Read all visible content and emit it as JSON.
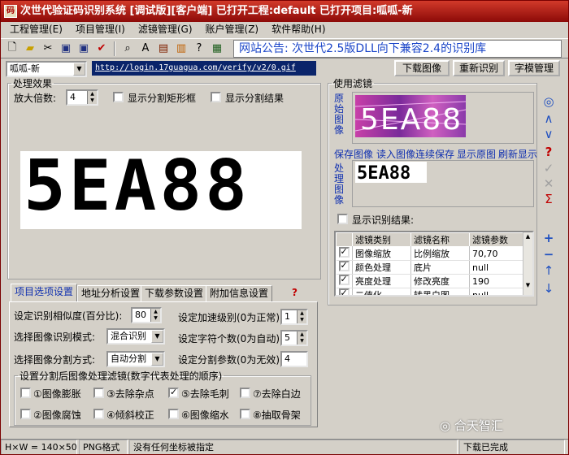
{
  "window": {
    "title": "次世代验证码识别系统 [调试版][客户端] 已打开工程:default 已打开项目:呱呱-新"
  },
  "menu": [
    "工程管理(E)",
    "项目管理(I)",
    "滤镜管理(G)",
    "账户管理(Z)",
    "软件帮助(H)"
  ],
  "announcement": "网站公告: 次世代2.5版DLL向下兼容2.4的识别库",
  "address": {
    "project": "呱呱-新",
    "url": "http://login.17guagua.com/verify/v2/0.gif"
  },
  "buttons": {
    "download": "下载图像",
    "reidentify": "重新识别",
    "charmodel": "字模管理"
  },
  "effect": {
    "legend": "处理效果",
    "zoom_label": "放大倍数:",
    "zoom_value": "4",
    "show_split_rect": "显示分割矩形框",
    "show_split_result": "显示分割结果",
    "captcha_text": "5EA88"
  },
  "tabs": [
    "项目选项设置",
    "地址分析设置",
    "下载参数设置",
    "附加信息设置"
  ],
  "options": {
    "similarity_label": "设定识别相似度(百分比):",
    "similarity_value": "80",
    "accel_label": "设定加速级别(0为正常)",
    "accel_value": "1",
    "mode_label": "选择图像识别模式:",
    "mode_value": "混合识别",
    "charcount_label": "设定字符个数(0为自动)",
    "charcount_value": "5",
    "split_label": "选择图像分割方式:",
    "split_value": "自动分割",
    "splitparam_label": "设定分割参数(0为无效)",
    "splitparam_value": "4",
    "postfilter_legend": "设置分割后图像处理滤镜(数字代表处理的顺序)",
    "postfilters": [
      {
        "label": "①图像膨胀",
        "checked": false
      },
      {
        "label": "③去除杂点",
        "checked": false
      },
      {
        "label": "⑤去除毛刺",
        "checked": true
      },
      {
        "label": "⑦去除白边",
        "checked": false
      },
      {
        "label": "②图像腐蚀",
        "checked": false
      },
      {
        "label": "④倾斜校正",
        "checked": false
      },
      {
        "label": "⑥图像缩水",
        "checked": false
      },
      {
        "label": "⑧抽取骨架",
        "checked": false
      }
    ]
  },
  "filters": {
    "legend": "使用滤镜",
    "original_label": "原始图像",
    "processed_label": "处理图像",
    "original_text": "5EA88",
    "processed_text": "5EA88",
    "links": [
      "保存图像",
      "读入图像",
      "连续保存",
      "显示原图",
      "刷新显示"
    ],
    "show_result": "显示识别结果:",
    "columns": [
      "滤镜类别",
      "滤镜名称",
      "滤镜参数"
    ],
    "rows": [
      {
        "category": "图像缩放",
        "name": "比例缩放",
        "param": "70,70",
        "checked": true
      },
      {
        "category": "颜色处理",
        "name": "底片",
        "param": "null",
        "checked": true
      },
      {
        "category": "亮度处理",
        "name": "修改亮度",
        "param": "190",
        "checked": true
      },
      {
        "category": "二值化",
        "name": "转黑白图",
        "param": "null",
        "checked": true
      }
    ]
  },
  "status": {
    "size": "H×W = 140×50",
    "format": "PNG格式",
    "coord": "没有任何坐标被指定",
    "download": "下载已完成"
  },
  "watermark": "合天智汇"
}
